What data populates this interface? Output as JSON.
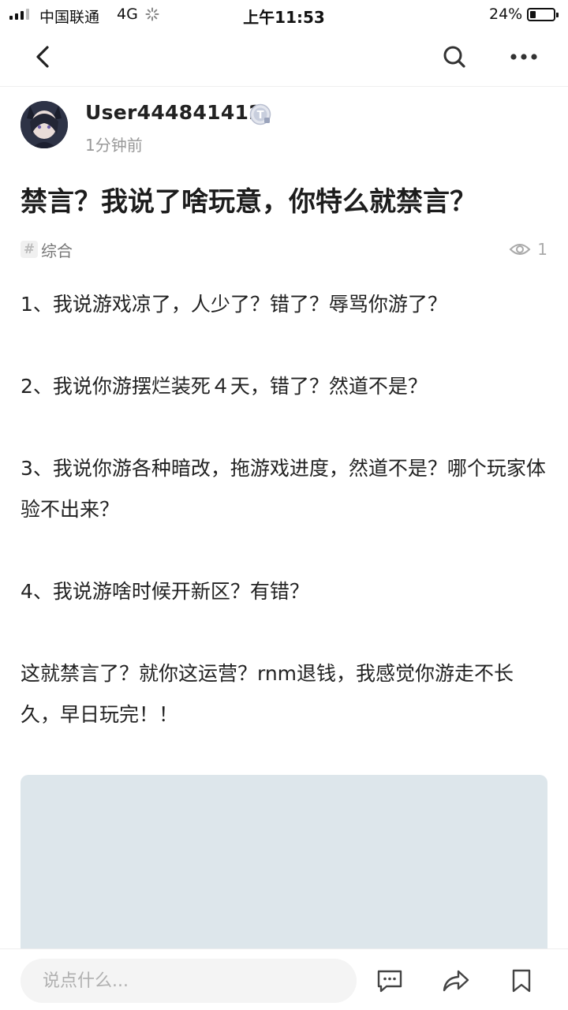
{
  "status_bar": {
    "carrier": "中国联通",
    "network": "4G",
    "time": "上午11:53",
    "battery_percent": "24%",
    "battery_level": 0.24
  },
  "nav": {
    "back_icon": "chevron-left-icon",
    "search_icon": "search-icon",
    "more_icon": "more-horizontal-icon"
  },
  "author": {
    "username": "User444841412",
    "badge_icon": "t-badge-icon",
    "time_ago": "1分钟前"
  },
  "post": {
    "title": "禁言？我说了啥玩意，你特么就禁言？",
    "tag": "综合",
    "views": "1",
    "paragraphs": [
      "1、我说游戏凉了，人少了？错了？辱骂你游了？",
      "2、我说你游摆烂装死４天，错了？然道不是？",
      "3、我说你游各种暗改，拖游戏进度，然道不是？哪个玩家体验不出来？",
      "4、我说游啥时候开新区？有错？",
      "这就禁言了？就你这运营？rnm退钱，我感觉你游走不长久，早日玩完！！"
    ]
  },
  "bottom_bar": {
    "comment_placeholder": "说点什么...",
    "comment_icon": "comment-icon",
    "share_icon": "share-icon",
    "bookmark_icon": "bookmark-icon"
  },
  "colors": {
    "image_placeholder": "#dde6eb",
    "muted_text": "#999999"
  }
}
